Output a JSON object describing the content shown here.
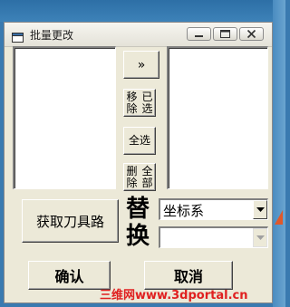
{
  "window": {
    "title": "批量更改",
    "icons": {
      "app": "window-app-icon",
      "minimize": "minimize-icon",
      "restore": "restore-icon",
      "close": "close-icon"
    }
  },
  "buttons": {
    "move_right": "»",
    "remove_selected_line1": "移除",
    "remove_selected_line2": "已选",
    "select_all": "全选",
    "delete_all_line1": "删除",
    "delete_all_line2": "全部",
    "fetch_toolpath": "获取刀具路",
    "confirm": "确认",
    "cancel": "取消"
  },
  "replace": {
    "char1": "替",
    "char2": "换"
  },
  "combos": {
    "coordinate": {
      "value": "坐标系"
    },
    "second": {
      "value": ""
    }
  },
  "lists": {
    "left": [],
    "right": []
  },
  "watermark": "三维网www.3dportal.cn",
  "colors": {
    "dialog_bg": "#ece9d8",
    "desktop": "#3a7ab0",
    "watermark": "#e02020"
  }
}
